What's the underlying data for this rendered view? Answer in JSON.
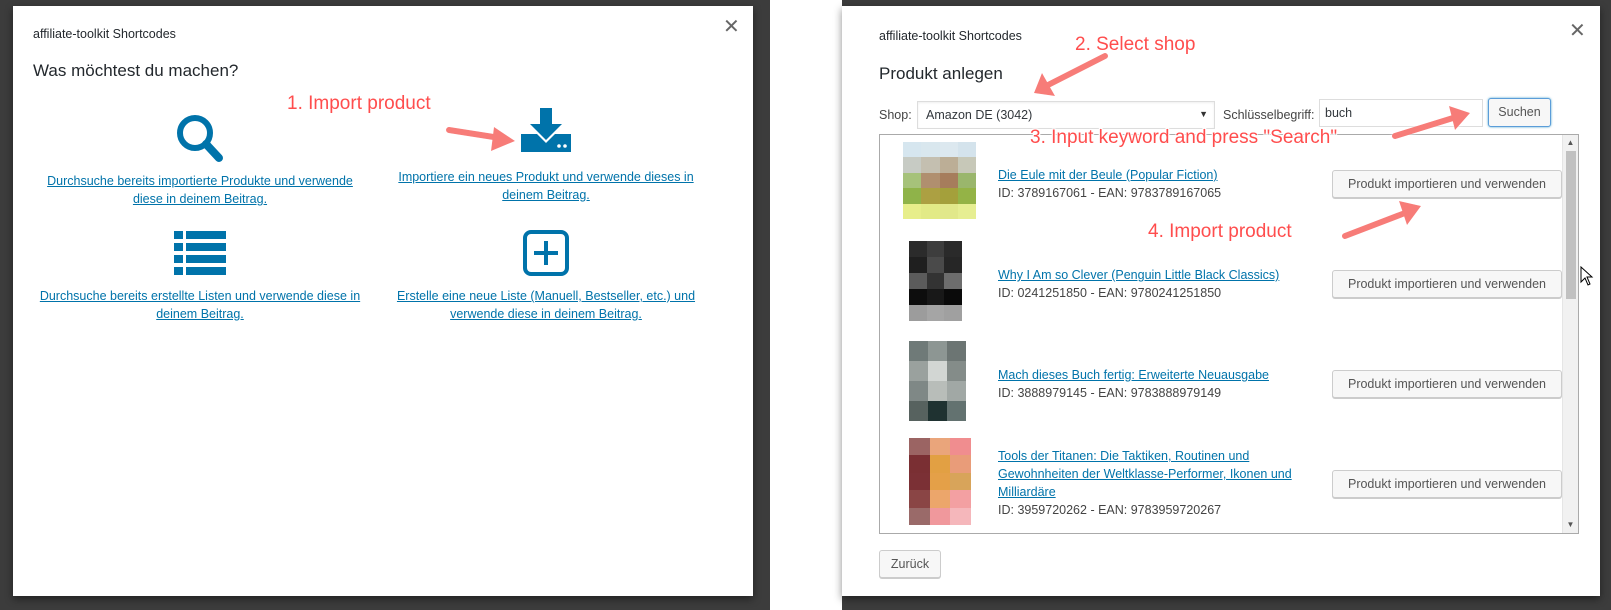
{
  "left_modal": {
    "title": "affiliate-toolkit Shortcodes",
    "heading": "Was möchtest du machen?",
    "options": [
      {
        "icon": "search-icon",
        "label": "Durchsuche bereits importierte Produkte und verwende diese in deinem Beitrag."
      },
      {
        "icon": "download-icon",
        "label": "Importiere ein neues Produkt und verwende dieses in deinem Beitrag."
      },
      {
        "icon": "list-icon",
        "label": "Durchsuche bereits erstellte Listen und verwende diese in deinem Beitrag."
      },
      {
        "icon": "plus-square-icon",
        "label": "Erstelle eine neue Liste (Manuell, Bestseller, etc.) und verwende diese in deinem Beitrag."
      }
    ]
  },
  "right_modal": {
    "title": "affiliate-toolkit Shortcodes",
    "heading": "Produkt anlegen",
    "shop_label": "Shop:",
    "shop_value": "Amazon DE (3042)",
    "keyword_label": "Schlüsselbegriff:",
    "keyword_value": "buch",
    "search_button": "Suchen",
    "back_button": "Zurück",
    "import_button": "Produkt importieren und verwenden",
    "results": [
      {
        "title": "Die Eule mit der Beule (Popular Fiction)",
        "meta": "ID: 3789167061 - EAN: 9783789167065"
      },
      {
        "title": "Why I Am so Clever (Penguin Little Black Classics)",
        "meta": "ID: 0241251850 - EAN: 9780241251850"
      },
      {
        "title": "Mach dieses Buch fertig: Erweiterte Neuausgabe",
        "meta": "ID: 3888979145 - EAN: 9783888979149"
      },
      {
        "title": "Tools der Titanen: Die Taktiken, Routinen und Gewohnheiten der Weltklasse-Performer, Ikonen und Milliardäre",
        "meta": "ID: 3959720262 - EAN: 9783959720267"
      }
    ]
  },
  "annotations": {
    "step1": "1. Import product",
    "step2": "2. Select shop",
    "step3": "3. Input keyword and press \"Search\"",
    "step4": "4. Import product"
  },
  "colors": {
    "link": "#0073aa",
    "icon": "#0073aa",
    "annotation": "#ff4d4d",
    "backdrop": "#3c3c3c"
  }
}
